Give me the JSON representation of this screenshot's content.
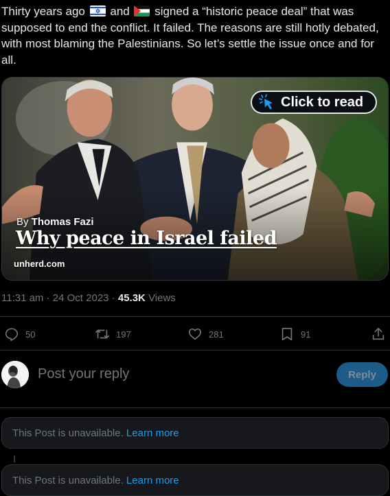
{
  "post": {
    "text_before_flag1": "Thirty years ago",
    "text_between_flags": "and",
    "text_after_flag2": "signed a “historic peace deal” that was supposed to end the conflict. It failed. The reasons are still hotly debated, with most blaming the Palestinians. So let’s settle the issue once and for all.",
    "flags": [
      "israel-flag-icon",
      "palestine-flag-icon"
    ]
  },
  "card": {
    "badge_label": "Click to read",
    "byline_prefix": "By",
    "author": "Thomas Fazi",
    "headline": "Why peace in Israel failed",
    "domain": "unherd.com"
  },
  "meta": {
    "time": "11:31 am",
    "separator": "·",
    "date": "24 Oct 2023",
    "views_count": "45.3K",
    "views_label": "Views"
  },
  "actions": {
    "replies": "50",
    "reposts": "197",
    "likes": "281",
    "bookmarks": "91"
  },
  "reply": {
    "placeholder": "Post your reply",
    "button_label": "Reply"
  },
  "unavailable": [
    {
      "text": "This Post is unavailable.",
      "link": "Learn more"
    },
    {
      "text": "This Post is unavailable.",
      "link": "Learn more"
    }
  ],
  "colors": {
    "background": "#000000",
    "text": "#e7e9ea",
    "muted": "#71767b",
    "accent": "#1d9bf0",
    "reply_button": "#1d5b88"
  }
}
